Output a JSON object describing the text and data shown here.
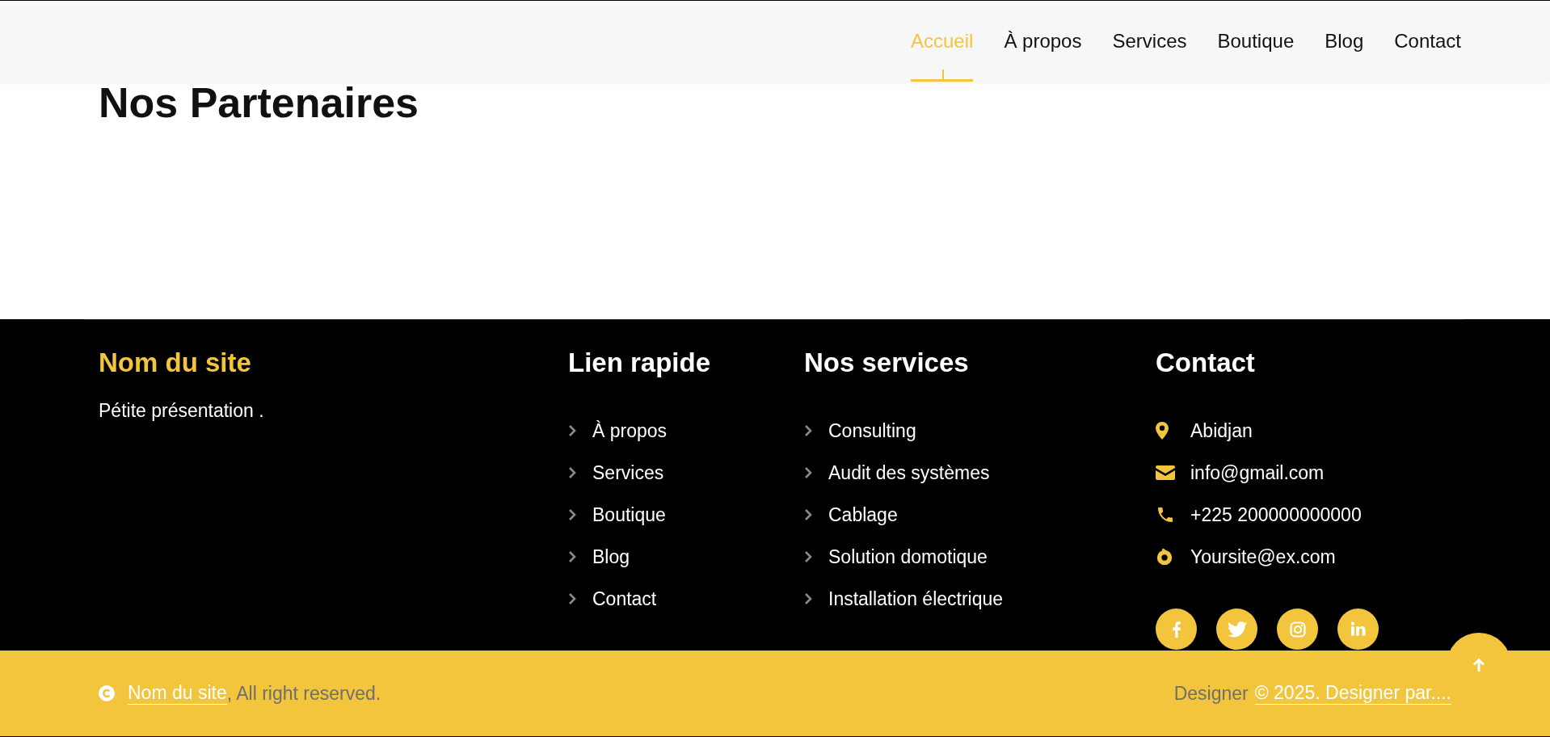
{
  "nav": {
    "items": [
      {
        "label": "Accueil",
        "selected": true
      },
      {
        "label": "À propos",
        "selected": false
      },
      {
        "label": "Services",
        "selected": false
      },
      {
        "label": "Boutique",
        "selected": false
      },
      {
        "label": "Blog",
        "selected": false
      },
      {
        "label": "Contact",
        "selected": false
      }
    ]
  },
  "page_title": "Nos Partenaires",
  "footer": {
    "brand": {
      "title": "Nom du site",
      "description": "Pétite présentation ."
    },
    "quick_links": {
      "heading": "Lien rapide",
      "items": [
        "À propos",
        "Services",
        "Boutique",
        "Blog",
        "Contact"
      ]
    },
    "services": {
      "heading": "Nos services",
      "items": [
        "Consulting",
        "Audit des systèmes",
        "Cablage",
        "Solution domotique",
        "Installation électrique"
      ]
    },
    "contact": {
      "heading": "Contact",
      "items": [
        {
          "kind": "location",
          "text": "Abidjan"
        },
        {
          "kind": "email",
          "text": "info@gmail.com"
        },
        {
          "kind": "phone",
          "text": "+225 200000000000"
        },
        {
          "kind": "web",
          "text": "Yoursite@ex.com"
        }
      ]
    }
  },
  "bottom_bar": {
    "site_link": "Nom du site",
    "rights": ", All right reserved.",
    "designer_label": "Designer",
    "designer_link": "© 2025. Designer par...."
  }
}
